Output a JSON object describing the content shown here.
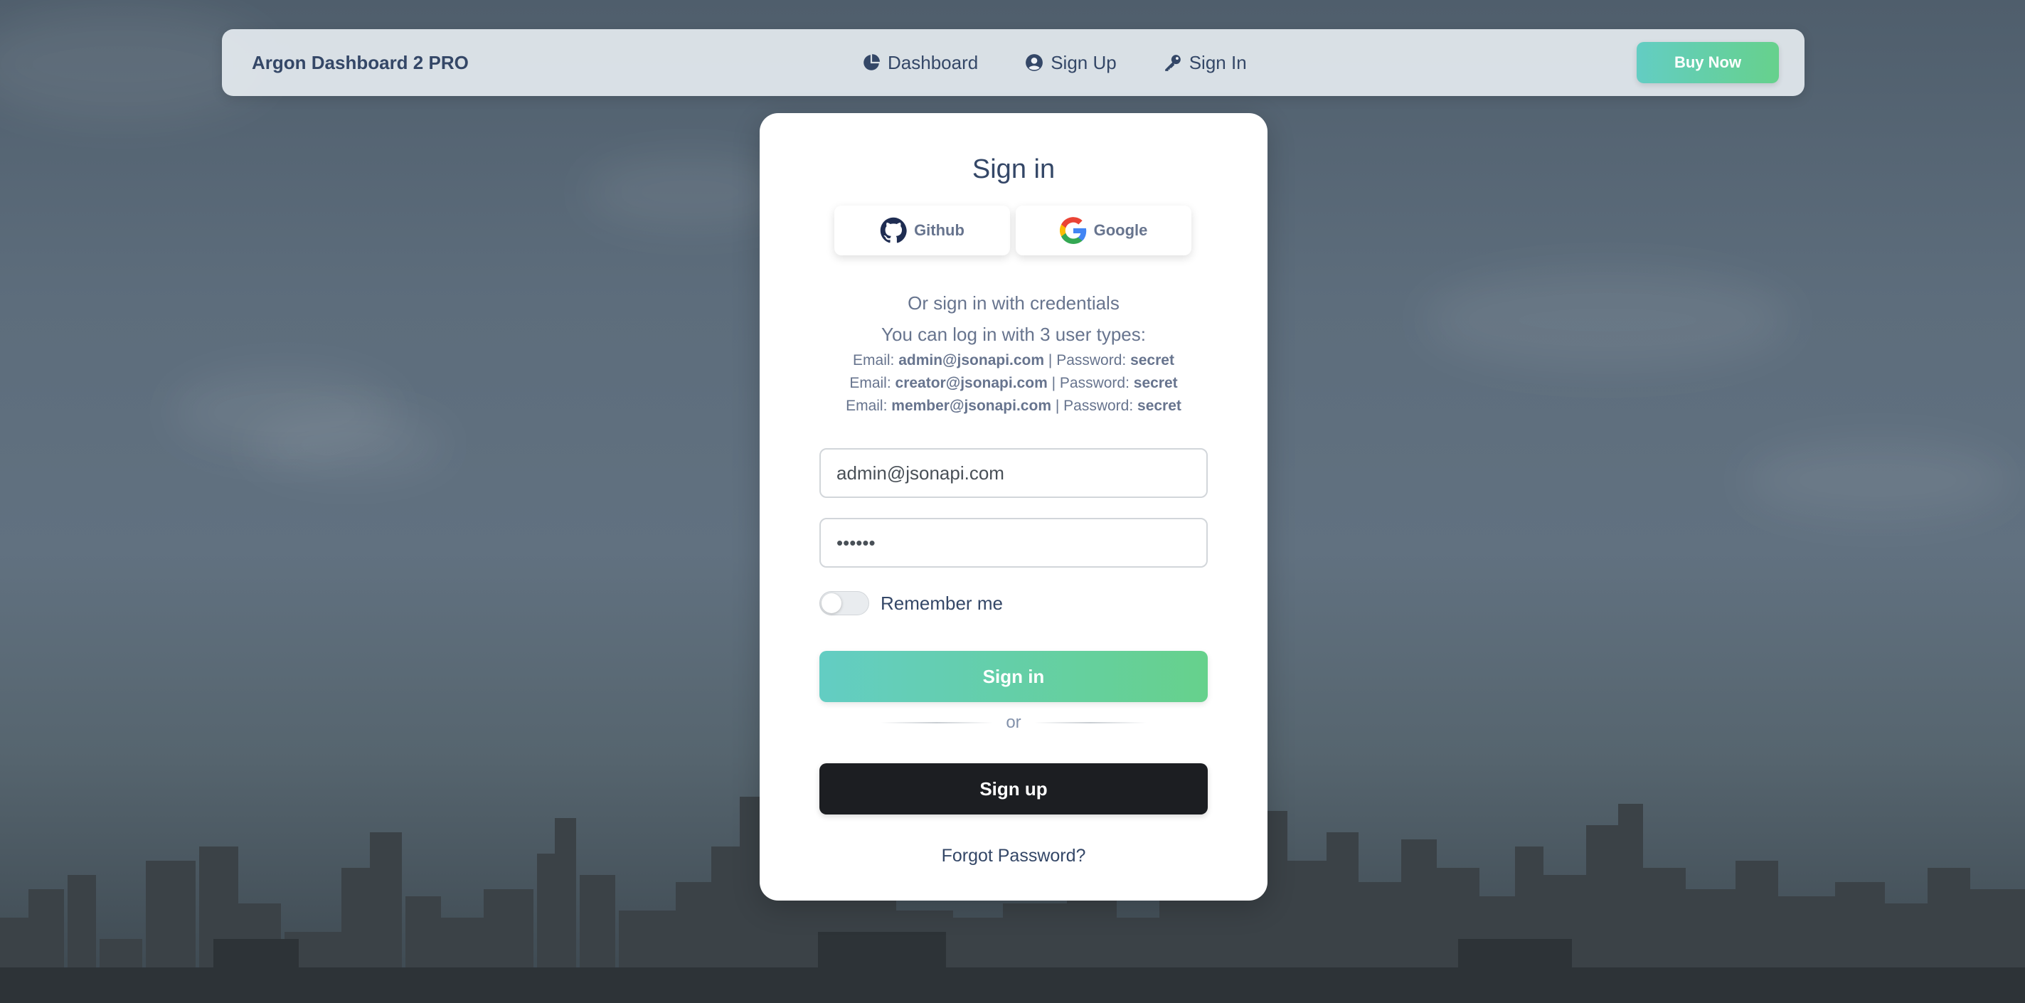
{
  "navbar": {
    "brand": "Argon Dashboard 2 PRO",
    "links": [
      {
        "label": "Dashboard",
        "icon": "pie-chart-icon"
      },
      {
        "label": "Sign Up",
        "icon": "user-circle-icon"
      },
      {
        "label": "Sign In",
        "icon": "key-icon"
      }
    ],
    "buy_now_label": "Buy Now"
  },
  "card": {
    "title": "Sign in",
    "social": [
      {
        "label": "Github",
        "icon": "github-icon"
      },
      {
        "label": "Google",
        "icon": "google-icon"
      }
    ],
    "or_credentials": "Or sign in with credentials",
    "user_types_note": "You can log in with 3 user types:",
    "credentials": [
      {
        "email_prefix": "Email:",
        "email": "admin@jsonapi.com",
        "sep": "| Password:",
        "password": "secret"
      },
      {
        "email_prefix": "Email:",
        "email": "creator@jsonapi.com",
        "sep": "| Password:",
        "password": "secret"
      },
      {
        "email_prefix": "Email:",
        "email": "member@jsonapi.com",
        "sep": "| Password:",
        "password": "secret"
      }
    ],
    "email_value": "admin@jsonapi.com",
    "password_value": "••••••",
    "remember_label": "Remember me",
    "remember_checked": false,
    "signin_label": "Sign in",
    "or_label": "or",
    "signup_label": "Sign up",
    "forgot_label": "Forgot Password?"
  },
  "colors": {
    "primary_text": "#344767",
    "muted_text": "#67748e",
    "gradient_start": "#63cdc3",
    "gradient_end": "#66d18c",
    "dark_button": "#1c1e22"
  }
}
